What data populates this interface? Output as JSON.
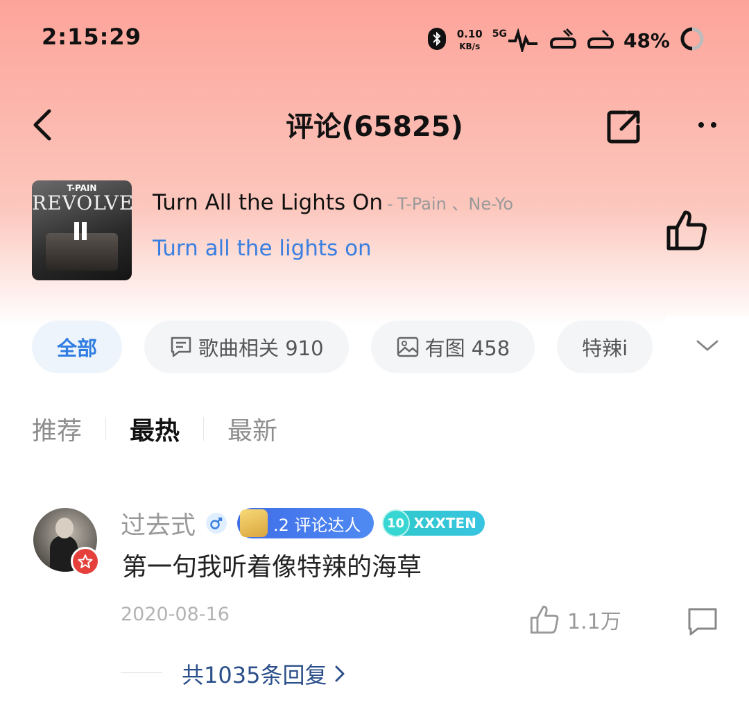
{
  "status": {
    "time": "2:15:29",
    "net_speed": "0.10",
    "net_unit": "KB/s",
    "network": "5G",
    "battery": "48%"
  },
  "header": {
    "title": "评论(65825)"
  },
  "song": {
    "title": "Turn All the Lights On",
    "separator": "-",
    "artist": "T-Pain 、Ne-Yo",
    "subtitle": "Turn all the lights on",
    "cover_text_top": "T-PAIN",
    "cover_text_main": "REVOLVER"
  },
  "chips": [
    {
      "label": "全部"
    },
    {
      "label": "歌曲相关 910"
    },
    {
      "label": "有图 458"
    },
    {
      "label": "特辣i"
    }
  ],
  "sort_tabs": [
    {
      "label": "推荐"
    },
    {
      "label": "最热"
    },
    {
      "label": "最新"
    }
  ],
  "comment": {
    "username": "过去式",
    "badge_critic": ".2 评论达人",
    "badge_fan_level": "10",
    "badge_fan_name": "XXXTEN",
    "text": "第一句我听着像特辣的海草",
    "date": "2020-08-16",
    "like_count": "1.1万",
    "replies": "共1035条回复"
  },
  "colors": {
    "accent_blue": "#3a7fe0",
    "active_chip_text": "#2f7de1",
    "reply_link": "#2b4f8a",
    "avatar_badge_red": "#e5403b"
  }
}
